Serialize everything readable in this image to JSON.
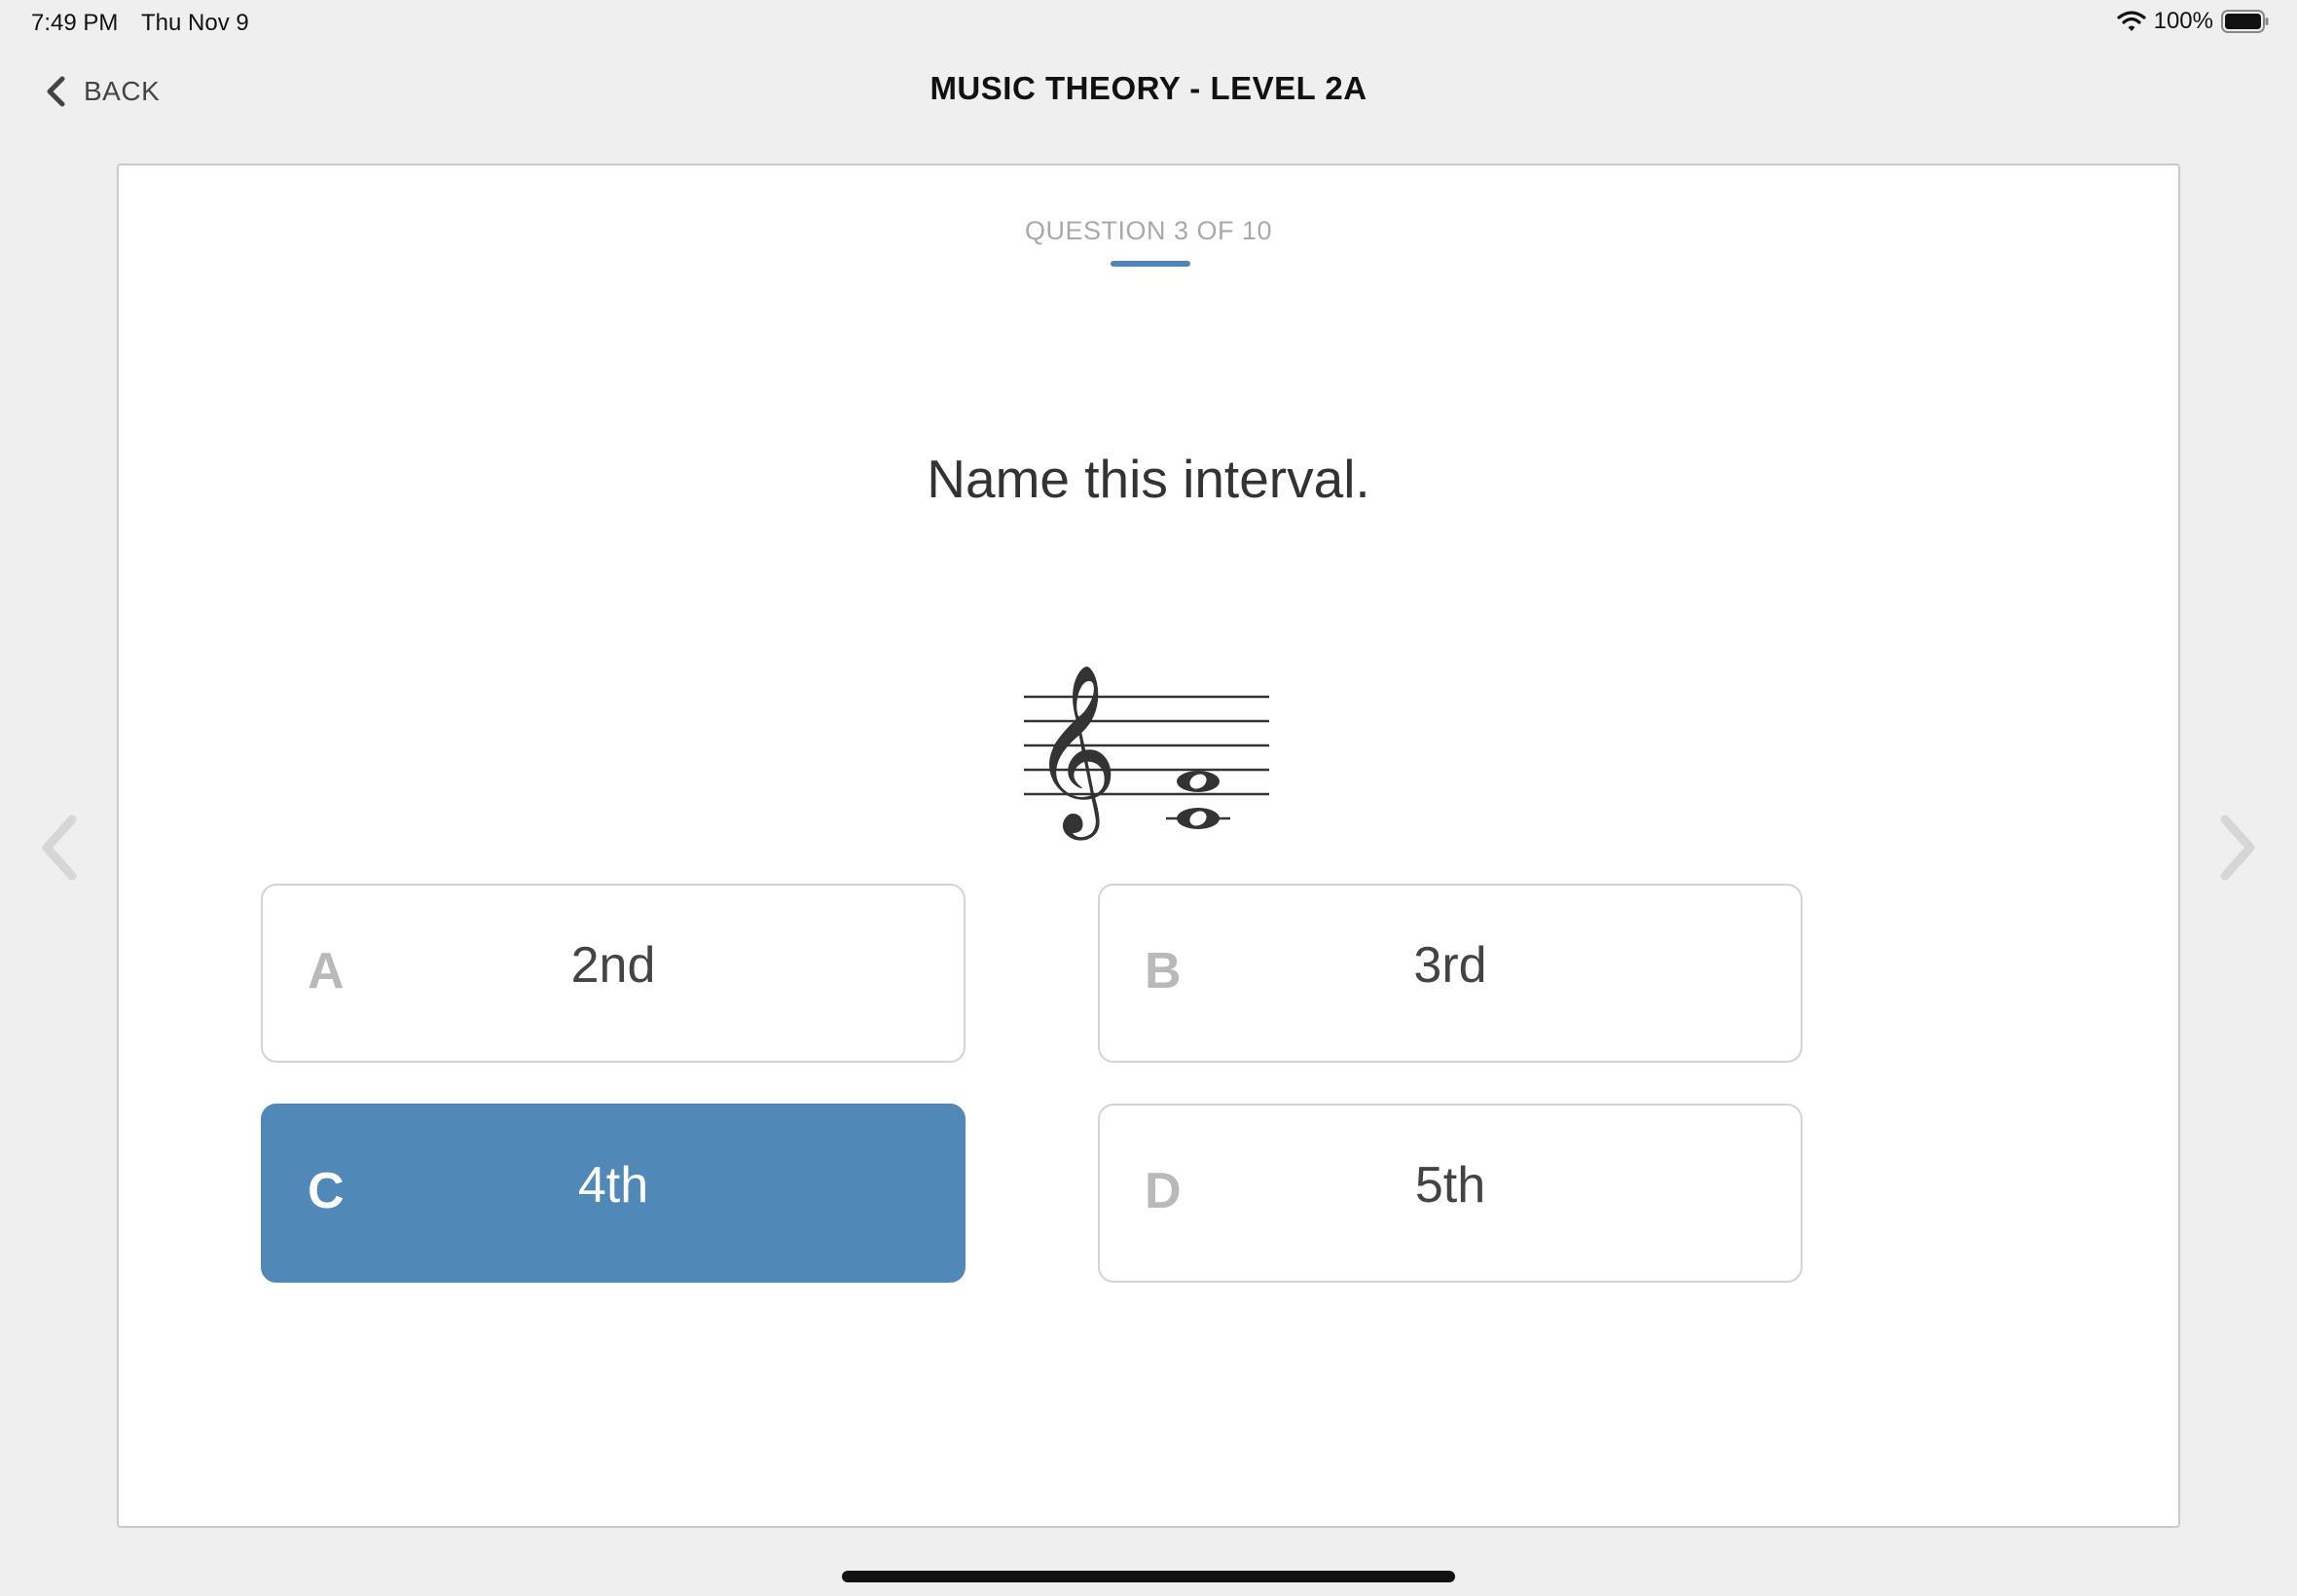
{
  "status_bar": {
    "time": "7:49 PM",
    "date": "Thu Nov 9",
    "battery": "100%",
    "icons": [
      "wifi-icon",
      "battery-icon"
    ]
  },
  "nav": {
    "back_label": "BACK",
    "back_icon": "chevron-left-icon",
    "title": "MUSIC THEORY - LEVEL 2A"
  },
  "quiz": {
    "counter": "QUESTION 3 OF 10",
    "question": "Name this interval.",
    "notation": {
      "clef": "treble",
      "notes": [
        "middle-c-whole",
        "f-whole"
      ]
    },
    "answers": [
      {
        "letter": "A",
        "label": "2nd",
        "selected": false
      },
      {
        "letter": "B",
        "label": "3rd",
        "selected": false
      },
      {
        "letter": "C",
        "label": "4th",
        "selected": true
      },
      {
        "letter": "D",
        "label": "5th",
        "selected": false
      }
    ]
  },
  "colors": {
    "accent": "#5088b7",
    "background": "#efefef",
    "card": "#ffffff"
  }
}
